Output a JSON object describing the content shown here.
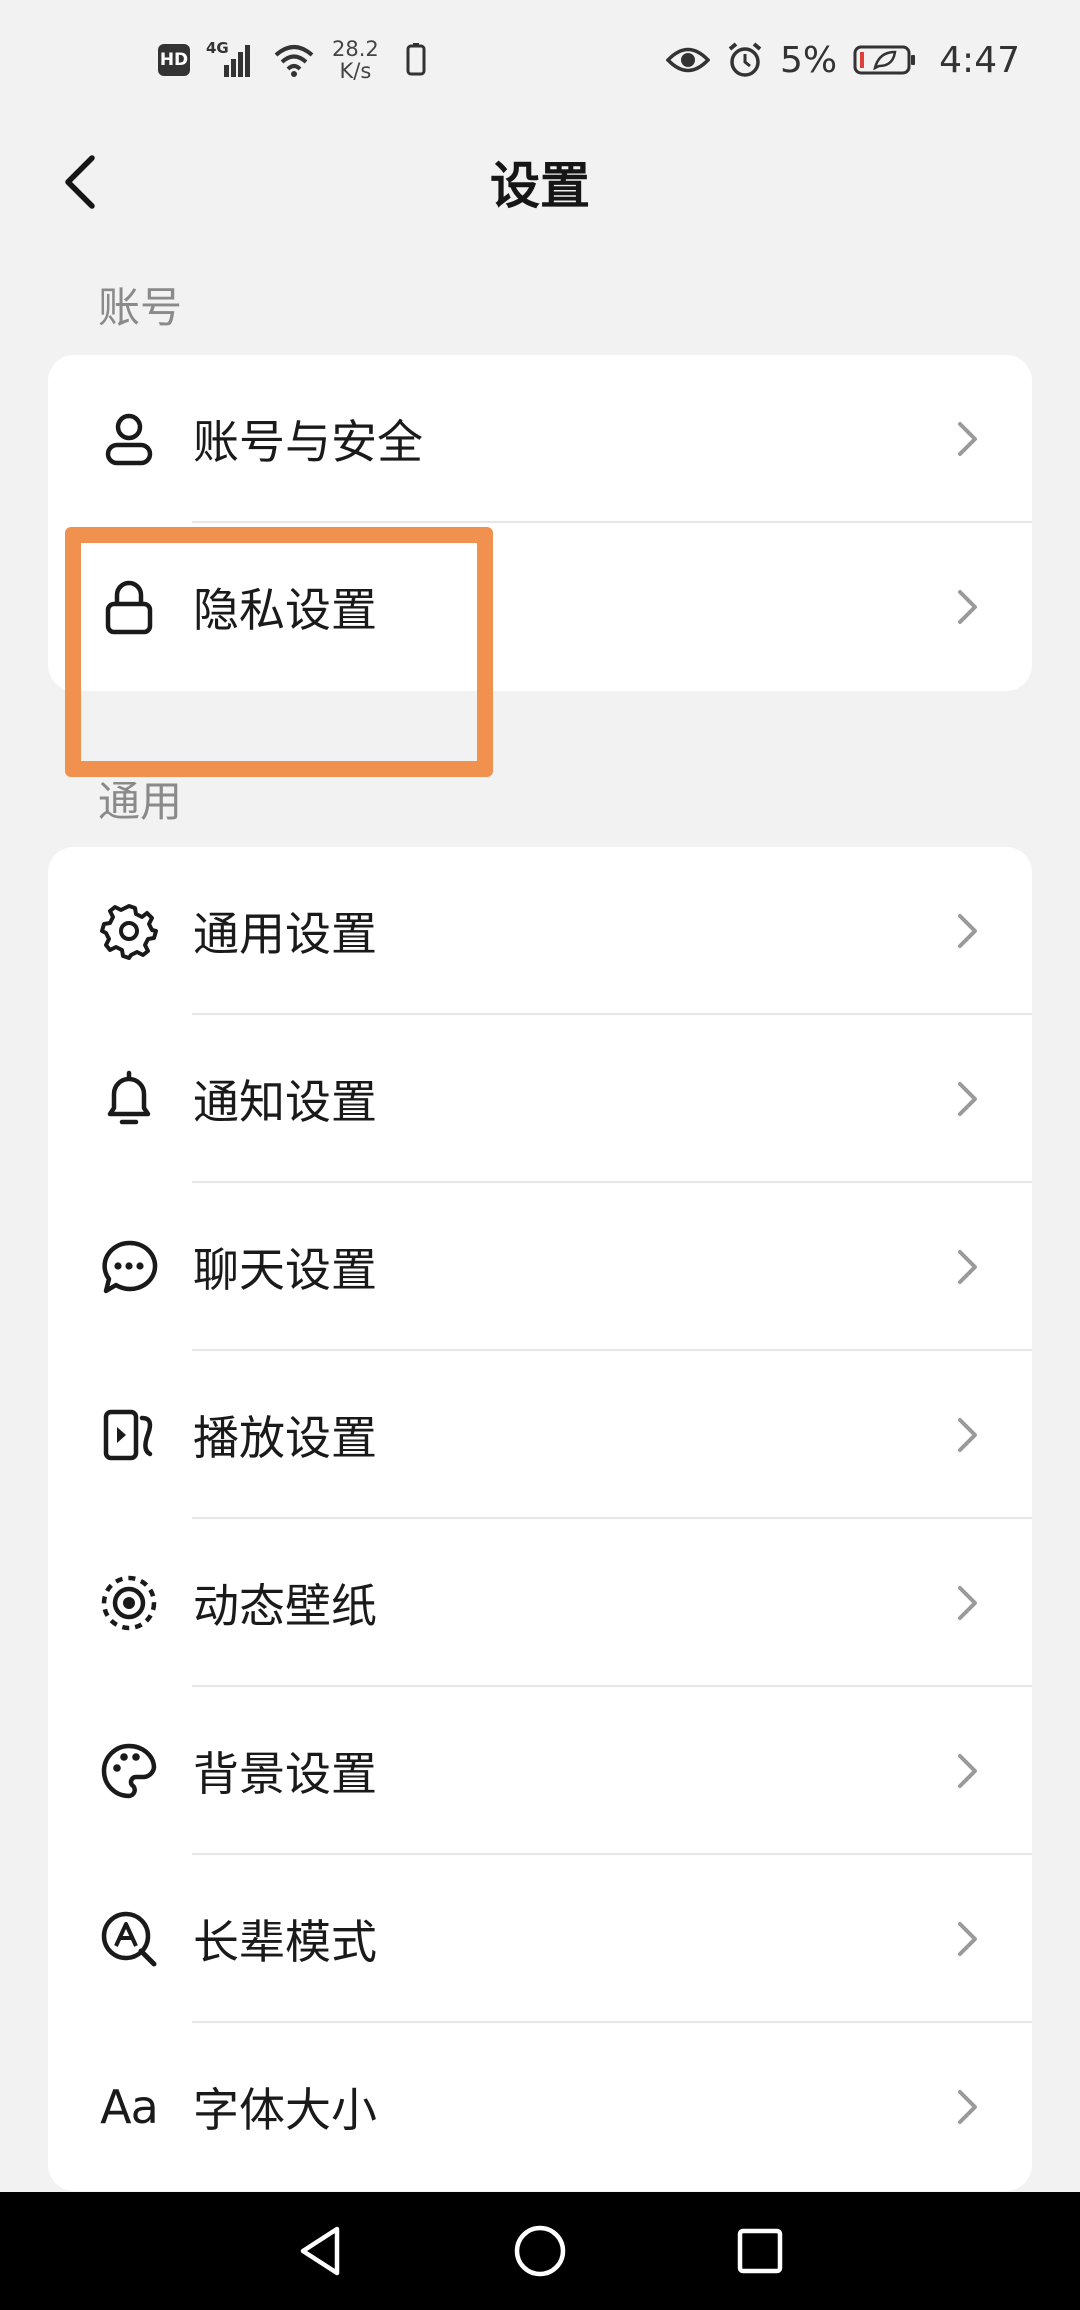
{
  "status_bar": {
    "hd_badge": "HD",
    "network_type": "4G",
    "speed_value": "28.2",
    "speed_unit": "K/s",
    "battery_percent": "5%",
    "time": "4:47"
  },
  "header": {
    "title": "设置"
  },
  "sections": {
    "account": {
      "label": "账号",
      "items": [
        {
          "label": "账号与安全",
          "icon": "user-icon"
        },
        {
          "label": "隐私设置",
          "icon": "lock-icon"
        }
      ]
    },
    "general": {
      "label": "通用",
      "items": [
        {
          "label": "通用设置",
          "icon": "gear-icon"
        },
        {
          "label": "通知设置",
          "icon": "bell-icon"
        },
        {
          "label": "聊天设置",
          "icon": "chat-bubble-icon"
        },
        {
          "label": "播放设置",
          "icon": "play-screen-icon"
        },
        {
          "label": "动态壁纸",
          "icon": "live-wallpaper-icon"
        },
        {
          "label": "背景设置",
          "icon": "palette-icon"
        },
        {
          "label": "长辈模式",
          "icon": "elder-mode-icon"
        },
        {
          "label": "字体大小",
          "icon": "font-size-icon",
          "icon_text": "Aa"
        }
      ]
    }
  },
  "colors": {
    "highlight": "#f0914f",
    "background": "#f2f2f2",
    "card": "#ffffff"
  }
}
